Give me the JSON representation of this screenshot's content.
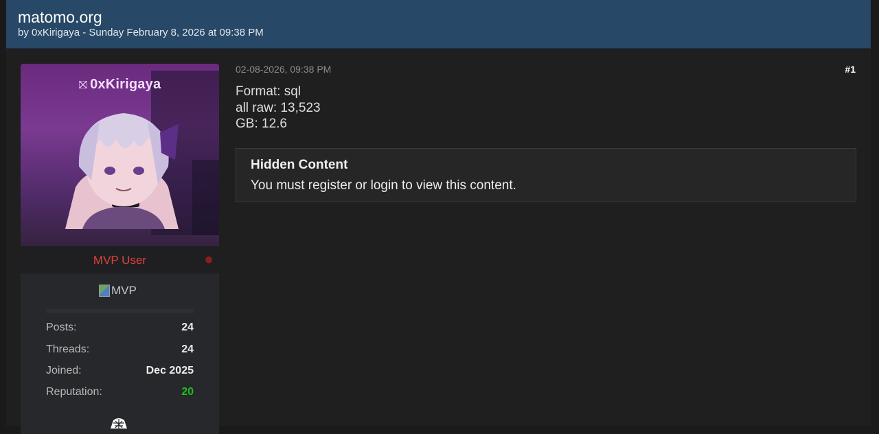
{
  "thread": {
    "title": "matomo.org",
    "byline": "by 0xKirigaya - Sunday February 8, 2026 at 09:38 PM"
  },
  "author": {
    "display_name": "0xKirigaya",
    "name_glyph": "⛝",
    "rank_title": "MVP User",
    "status_color": "#8a1e1e",
    "badge_alt": "MVP",
    "stats": [
      {
        "label": "Posts:",
        "value": "24"
      },
      {
        "label": "Threads:",
        "value": "24"
      },
      {
        "label": "Joined:",
        "value": "Dec 2025"
      },
      {
        "label": "Reputation:",
        "value": "20"
      }
    ]
  },
  "post": {
    "date": "02-08-2026, 09:38 PM",
    "number": "#1",
    "body_lines": [
      "Format: sql",
      "all raw: 13,523",
      "GB: 12.6"
    ],
    "hidden": {
      "title": "Hidden Content",
      "text": "You must register or login to view this content."
    }
  },
  "colors": {
    "header_bg": "#274866",
    "rank_color": "#e0443a",
    "reputation_color": "#1fbf1f"
  }
}
